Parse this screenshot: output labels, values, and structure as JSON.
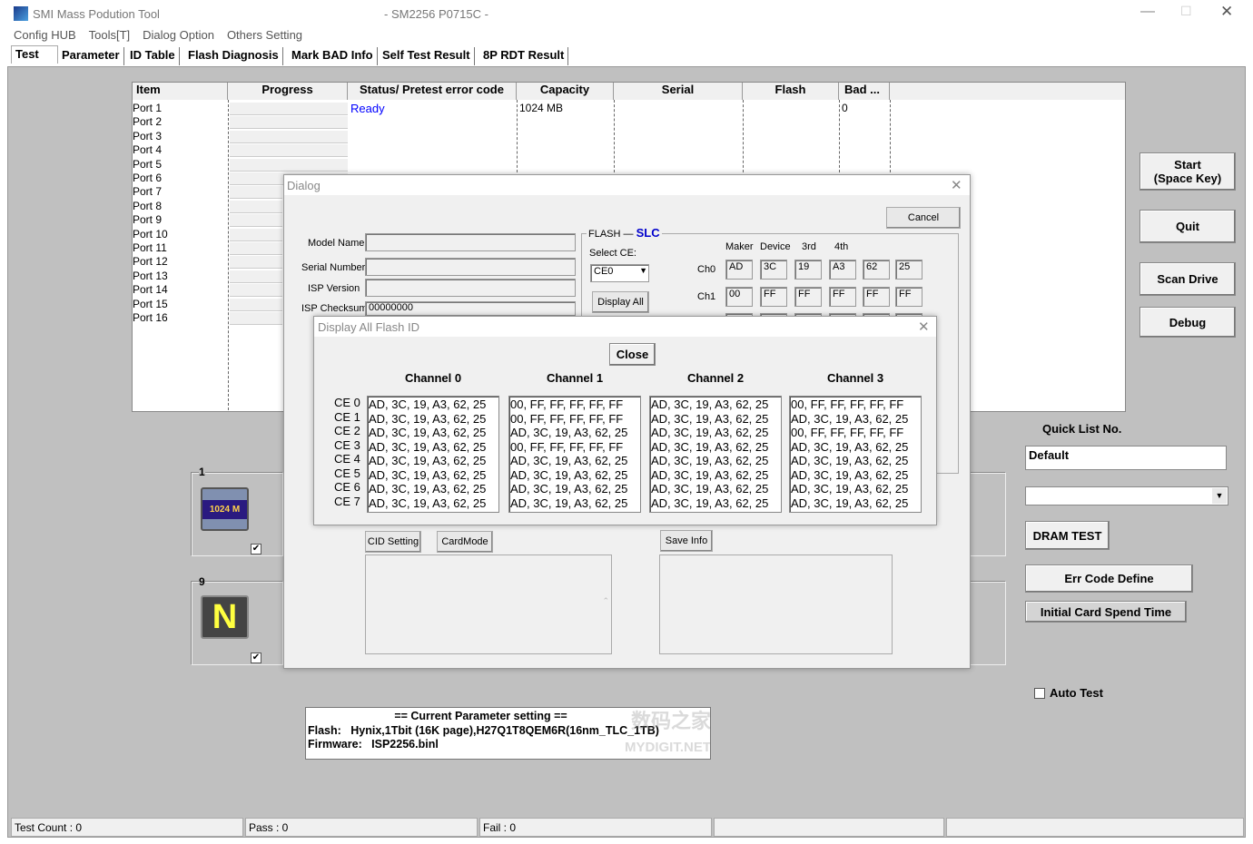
{
  "window": {
    "title": "SMI Mass Podution Tool",
    "subtitle": "- SM2256 P0715C -"
  },
  "menu": [
    "Config HUB",
    "Tools[T]",
    "Dialog Option",
    "Others Setting"
  ],
  "tabs": [
    "Test",
    "Parameter",
    "ID Table",
    "Flash Diagnosis",
    "Mark BAD Info",
    "Self Test Result",
    "8P RDT Result"
  ],
  "table": {
    "headers": [
      "Item",
      "Progress",
      "Status/ Pretest error code",
      "Capacity",
      "Serial",
      "Flash",
      "Bad ..."
    ],
    "ports": [
      "Port 1",
      "Port 2",
      "Port 3",
      "Port 4",
      "Port 5",
      "Port 6",
      "Port 7",
      "Port 8",
      "Port 9",
      "Port 10",
      "Port 11",
      "Port 12",
      "Port 13",
      "Port 14",
      "Port 15",
      "Port 16"
    ],
    "row1": {
      "status": "Ready",
      "capacity": "1024 MB",
      "bad": "0"
    }
  },
  "dialog": {
    "title": "Dialog",
    "cancel": "Cancel",
    "model_name_label": "Model Name",
    "serial_label": "Serial Number",
    "isp_version_label": "ISP Version",
    "isp_checksum_label": "ISP Checksum",
    "isp_checksum": "00000000",
    "flash_label": "FLASH",
    "flash_type": "SLC",
    "select_ce_label": "Select CE:",
    "select_ce": "CE0",
    "display_all": "Display All",
    "id_headers": [
      "Maker",
      "Device",
      "3rd",
      "4th"
    ],
    "ch0_label": "Ch0",
    "ch0": [
      "AD",
      "3C",
      "19",
      "A3",
      "62",
      "25"
    ],
    "ch1_label": "Ch1",
    "ch1": [
      "00",
      "FF",
      "FF",
      "FF",
      "FF",
      "FF"
    ],
    "cid_setting": "CID Setting",
    "card_mode": "CardMode",
    "save_info": "Save Info"
  },
  "flash_id": {
    "title": "Display All Flash ID",
    "close": "Close",
    "channels": [
      "Channel 0",
      "Channel 1",
      "Channel 2",
      "Channel 3"
    ],
    "ce_labels": [
      "CE 0",
      "CE 1",
      "CE 2",
      "CE 3",
      "CE 4",
      "CE 5",
      "CE 6",
      "CE 7"
    ],
    "values": [
      [
        "AD, 3C, 19, A3, 62, 25",
        "AD, 3C, 19, A3, 62, 25",
        "AD, 3C, 19, A3, 62, 25",
        "AD, 3C, 19, A3, 62, 25",
        "AD, 3C, 19, A3, 62, 25",
        "AD, 3C, 19, A3, 62, 25",
        "AD, 3C, 19, A3, 62, 25",
        "AD, 3C, 19, A3, 62, 25"
      ],
      [
        "00, FF, FF, FF, FF, FF",
        "00, FF, FF, FF, FF, FF",
        "AD, 3C, 19, A3, 62, 25",
        "00, FF, FF, FF, FF, FF",
        "AD, 3C, 19, A3, 62, 25",
        "AD, 3C, 19, A3, 62, 25",
        "AD, 3C, 19, A3, 62, 25",
        "AD, 3C, 19, A3, 62, 25"
      ],
      [
        "AD, 3C, 19, A3, 62, 25",
        "AD, 3C, 19, A3, 62, 25",
        "AD, 3C, 19, A3, 62, 25",
        "AD, 3C, 19, A3, 62, 25",
        "AD, 3C, 19, A3, 62, 25",
        "AD, 3C, 19, A3, 62, 25",
        "AD, 3C, 19, A3, 62, 25",
        "AD, 3C, 19, A3, 62, 25"
      ],
      [
        "00, FF, FF, FF, FF, FF",
        "AD, 3C, 19, A3, 62, 25",
        "00, FF, FF, FF, FF, FF",
        "AD, 3C, 19, A3, 62, 25",
        "AD, 3C, 19, A3, 62, 25",
        "AD, 3C, 19, A3, 62, 25",
        "AD, 3C, 19, A3, 62, 25",
        "AD, 3C, 19, A3, 62, 25"
      ]
    ]
  },
  "ports_panel": [
    {
      "number": "1",
      "icon_text": "1024 M",
      "checked": true
    },
    {
      "number": "9",
      "icon_text": "N",
      "checked": true
    }
  ],
  "parameter": {
    "heading": "== Current Parameter setting ==",
    "flash": "Flash:   Hynix,1Tbit (16K page),H27Q1T8QEM6R(16nm_TLC_1TB)",
    "firmware": "Firmware:   ISP2256.binl",
    "watermark": "数码之家 MYDIGIT.NET"
  },
  "right": {
    "start": "Start\n(Space Key)",
    "quit": "Quit",
    "scan": "Scan Drive",
    "debug": "Debug",
    "quick_list_label": "Quick List No.",
    "quick_list_value": "Default",
    "dram": "DRAM TEST",
    "err": "Err Code Define",
    "initial": "Initial Card Spend Time",
    "auto_test": "Auto Test"
  },
  "statusbar": [
    "Test Count : 0",
    "Pass : 0",
    "Fail : 0",
    "",
    ""
  ],
  "colors": {
    "panel": "#c0c0c0",
    "dialog": "#f0f0f0",
    "ready": "#0000ff",
    "slc": "#0000cc"
  }
}
